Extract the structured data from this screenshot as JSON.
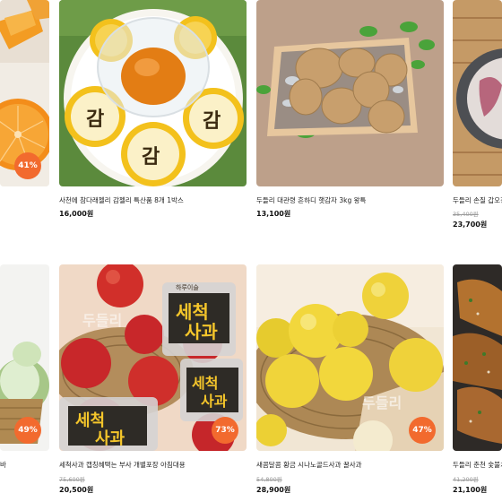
{
  "colors": {
    "accent": "#f26a2e",
    "price": "#111111",
    "original_price": "#999999"
  },
  "products": [
    {
      "discount": "41%",
      "title": "",
      "original_price": "",
      "price": "",
      "image": "orange-slices-photo"
    },
    {
      "discount": "",
      "title": "사천에 참다래젤리 감젤리 특산품 8개 1박스",
      "original_price": "",
      "price": "16,000원",
      "image": "persimmon-jelly-cups-photo"
    },
    {
      "discount": "",
      "title": "두들리 대관령 흔하디 햇감자 3kg 왕특",
      "original_price": "",
      "price": "13,100원",
      "image": "potato-crate-photo"
    },
    {
      "discount": "",
      "title": "두들리 손질 갑오징",
      "original_price": "35,400원",
      "price": "23,700원",
      "image": "squid-bowl-photo"
    },
    {
      "discount": "49%",
      "title": "바",
      "original_price": "",
      "price": "",
      "image": "cabbage-basket-photo"
    },
    {
      "discount": "73%",
      "title": "세척사과 캡칭혜택는 부사 개별포장 아침대용",
      "original_price": "75,600원",
      "price": "20,500원",
      "image": "washed-apples-photo",
      "package_text": [
        "세척",
        "사과"
      ],
      "package_brand": "하루이슬",
      "watermark": "두들리"
    },
    {
      "discount": "47%",
      "title": "새콤달콤 황금 시나노골드사과 꿀사과",
      "original_price": "54,800원",
      "price": "28,900원",
      "image": "golden-apples-photo",
      "watermark": "두들리"
    },
    {
      "discount": "",
      "title": "두들리 춘천 숯불치킨",
      "original_price": "41,200원",
      "price": "21,100원",
      "image": "grilled-chicken-photo"
    }
  ]
}
